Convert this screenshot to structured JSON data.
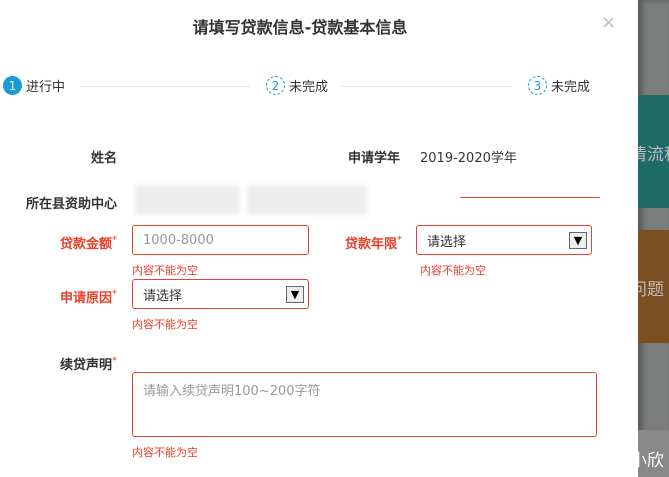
{
  "title": "请填写贷款信息-贷款基本信息",
  "close_icon": "×",
  "steps": [
    {
      "num": "1",
      "label": "进行中"
    },
    {
      "num": "2",
      "label": "未完成"
    },
    {
      "num": "3",
      "label": "未完成"
    }
  ],
  "form": {
    "name_label": "姓名",
    "year_label": "申请学年",
    "year_value": "2019-2020学年",
    "center_label": "所在县资助中心",
    "amount_label": "贷款金额",
    "amount_placeholder": "1000-8000",
    "amount_error": "内容不能为空",
    "term_label": "贷款年限",
    "term_value": "请选择",
    "term_error": "内容不能为空",
    "reason_label": "申请原因",
    "reason_value": "请选择",
    "reason_error": "内容不能为空",
    "statement_label": "续贷声明",
    "statement_placeholder": "请输入续贷声明100~200字符",
    "statement_error": "内容不能为空",
    "required_mark": "*"
  },
  "background": {
    "text1": "清流程",
    "text2": "问题",
    "text3": "小欣"
  },
  "colors": {
    "accent": "#1a9bd7",
    "error": "#e8412c"
  }
}
